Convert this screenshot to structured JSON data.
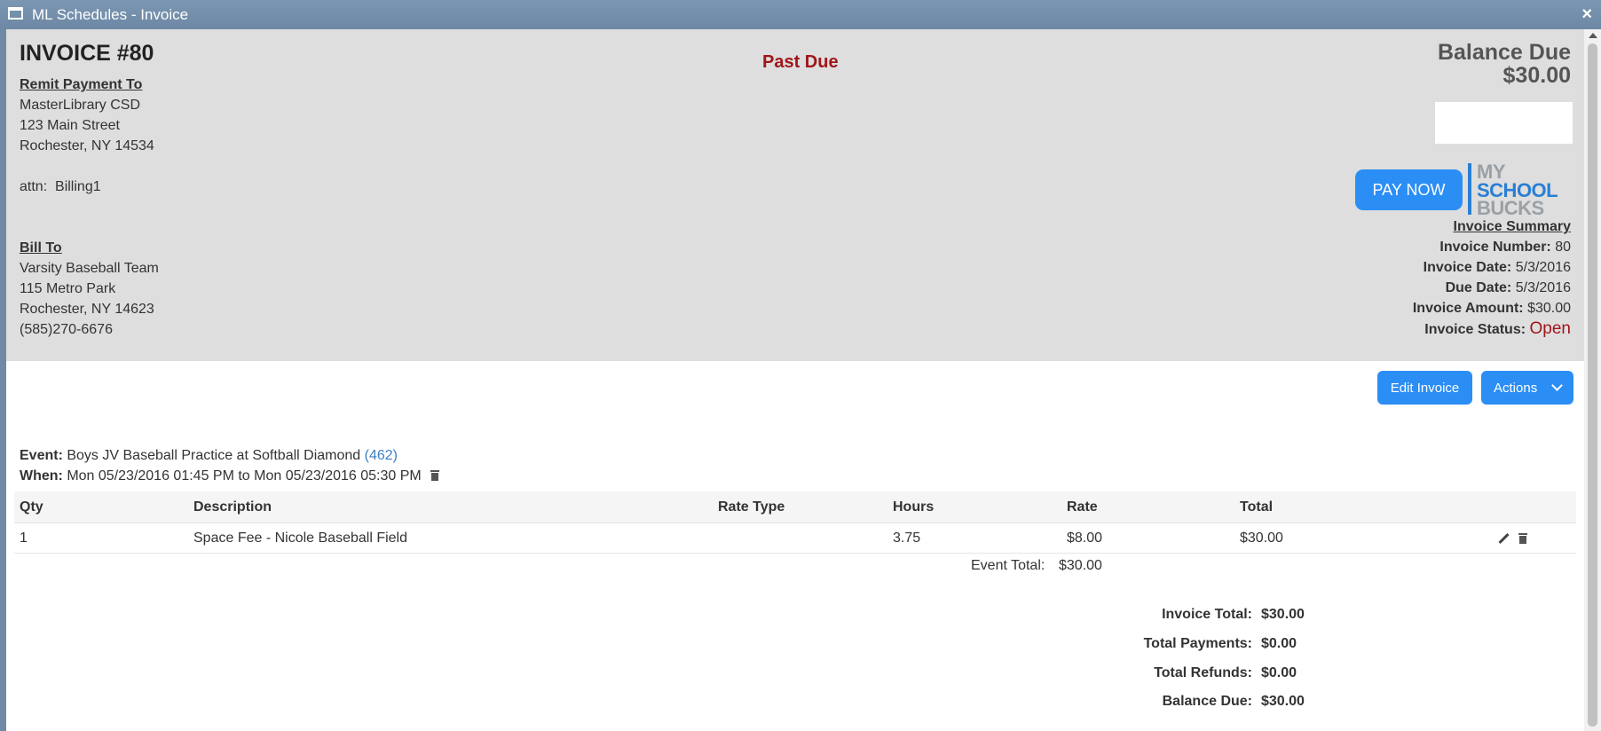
{
  "window": {
    "title": "ML Schedules - Invoice",
    "close_label": "×"
  },
  "invoice": {
    "title": "INVOICE #80",
    "status_banner": "Past Due",
    "balance_label": "Balance Due",
    "balance_value": "$30.00"
  },
  "remit": {
    "label": "Remit Payment To",
    "lines": [
      "MasterLibrary CSD",
      "123 Main Street",
      "Rochester, NY 14534"
    ],
    "attn": "attn:  Billing1"
  },
  "bill_to": {
    "label": "Bill To",
    "lines": [
      "Varsity Baseball Team",
      "115 Metro Park",
      "Rochester, NY 14623",
      "(585)270-6676"
    ]
  },
  "pay": {
    "button_label": "PAY NOW",
    "logo_lines": [
      "MY",
      "SCHOOL",
      "BUCKS"
    ]
  },
  "summary": {
    "title": "Invoice Summary",
    "number_label": "Invoice Number:",
    "number_value": "80",
    "date_label": "Invoice Date:",
    "date_value": "5/3/2016",
    "due_label": "Due Date:",
    "due_value": "5/3/2016",
    "amount_label": "Invoice Amount:",
    "amount_value": "$30.00",
    "status_label": "Invoice Status:",
    "status_value": "Open"
  },
  "toolbar": {
    "edit_label": "Edit Invoice",
    "actions_label": "Actions"
  },
  "event": {
    "event_label": "Event:",
    "event_name": "Boys JV Baseball Practice at Softball Diamond",
    "event_id": "(462)",
    "when_label": "When:",
    "when_value": "Mon 05/23/2016 01:45 PM to Mon 05/23/2016 05:30 PM"
  },
  "table": {
    "headers": [
      "Qty",
      "Description",
      "Rate Type",
      "Hours",
      "Rate",
      "Total"
    ],
    "rows": [
      {
        "qty": "1",
        "description": "Space Fee - Nicole Baseball Field",
        "rate_type": "",
        "hours": "3.75",
        "rate": "$8.00",
        "total": "$30.00"
      }
    ],
    "event_total_label": "Event Total:",
    "event_total_value": "$30.00"
  },
  "totals": {
    "invoice_total_label": "Invoice Total:",
    "invoice_total_value": "$30.00",
    "payments_label": "Total Payments:",
    "payments_value": "$0.00",
    "refunds_label": "Total Refunds:",
    "refunds_value": "$0.00",
    "balance_label": "Balance Due:",
    "balance_value": "$30.00"
  },
  "colors": {
    "accent": "#2b8ef5",
    "past_due": "#a0151a",
    "header_bg": "#dedede",
    "titlebar": "#6f8aa6"
  }
}
